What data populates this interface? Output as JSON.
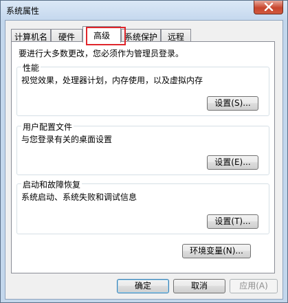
{
  "window": {
    "title": "系统属性"
  },
  "tabs": [
    {
      "label": "计算机名"
    },
    {
      "label": "硬件"
    },
    {
      "label": "高级"
    },
    {
      "label": "系统保护"
    },
    {
      "label": "远程"
    }
  ],
  "active_tab": "高级",
  "highlight_color": "#e0252b",
  "notice": "要进行大多数更改，您必须作为管理员登录。",
  "groups": {
    "performance": {
      "title": "性能",
      "description": "视觉效果，处理器计划，内存使用，以及虚拟内存",
      "button": "设置(S)..."
    },
    "user_profiles": {
      "title": "用户配置文件",
      "description": "与您登录有关的桌面设置",
      "button": "设置(E)..."
    },
    "startup_recovery": {
      "title": "启动和故障恢复",
      "description": "系统启动、系统失败和调试信息",
      "button": "设置(T)..."
    }
  },
  "env_button": "环境变量(N)...",
  "footer": {
    "ok": "确定",
    "cancel": "取消",
    "apply": "应用(A)"
  }
}
